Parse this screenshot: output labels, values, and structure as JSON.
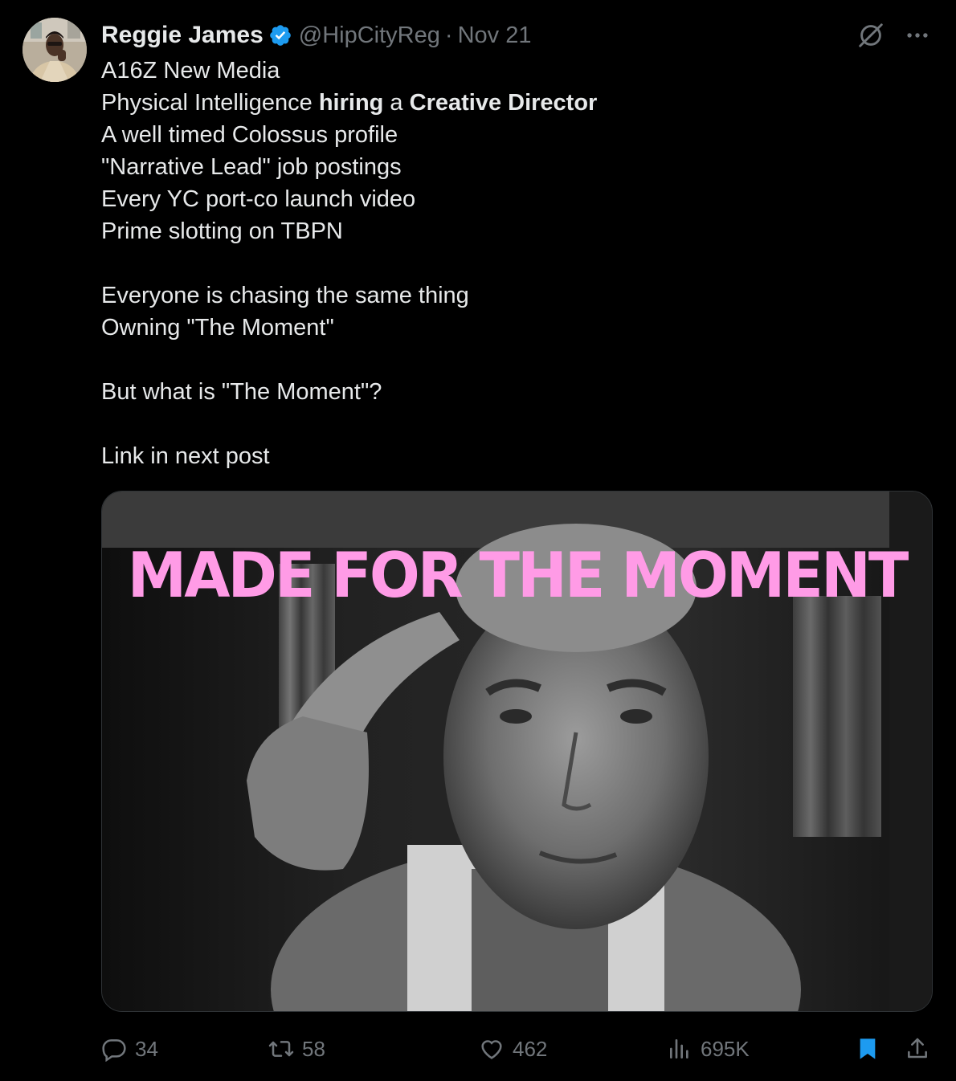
{
  "tweet": {
    "author": {
      "name": "Reggie James",
      "handle": "@HipCityReg",
      "separator": "·",
      "date": "Nov 21",
      "verified_color": "#1d9bf0"
    },
    "lines": [
      {
        "segments": [
          {
            "text": "A16Z New Media",
            "bold": false
          }
        ]
      },
      {
        "segments": [
          {
            "text": "Physical Intelligence ",
            "bold": false
          },
          {
            "text": "hiring",
            "bold": true
          },
          {
            "text": " a ",
            "bold": false
          },
          {
            "text": "Creative Director",
            "bold": true
          }
        ]
      },
      {
        "segments": [
          {
            "text": "A well timed Colossus profile",
            "bold": false
          }
        ]
      },
      {
        "segments": [
          {
            "text": "\"Narrative Lead\" job postings",
            "bold": false
          }
        ]
      },
      {
        "segments": [
          {
            "text": "Every YC port-co launch video",
            "bold": false
          }
        ]
      },
      {
        "segments": [
          {
            "text": "Prime slotting on TBPN",
            "bold": false
          }
        ]
      },
      {
        "segments": []
      },
      {
        "segments": [
          {
            "text": "Everyone is chasing the same thing",
            "bold": false
          }
        ]
      },
      {
        "segments": [
          {
            "text": "Owning \"The Moment\"",
            "bold": false
          }
        ]
      },
      {
        "segments": []
      },
      {
        "segments": [
          {
            "text": "But what is \"The Moment\"?",
            "bold": false
          }
        ]
      },
      {
        "segments": []
      },
      {
        "segments": [
          {
            "text": "Link in next post",
            "bold": false
          }
        ]
      }
    ],
    "media": {
      "overlay_text": "MADE FOR THE MOMENT",
      "overlay_color": "#ff9be6"
    },
    "actions": {
      "replies": "34",
      "retweets": "58",
      "likes": "462",
      "views": "695K",
      "bookmark_color": "#1d9bf0"
    },
    "icons": [
      "grok-icon",
      "more-icon",
      "reply-icon",
      "retweet-icon",
      "like-icon",
      "views-icon",
      "bookmark-icon",
      "share-icon"
    ]
  }
}
